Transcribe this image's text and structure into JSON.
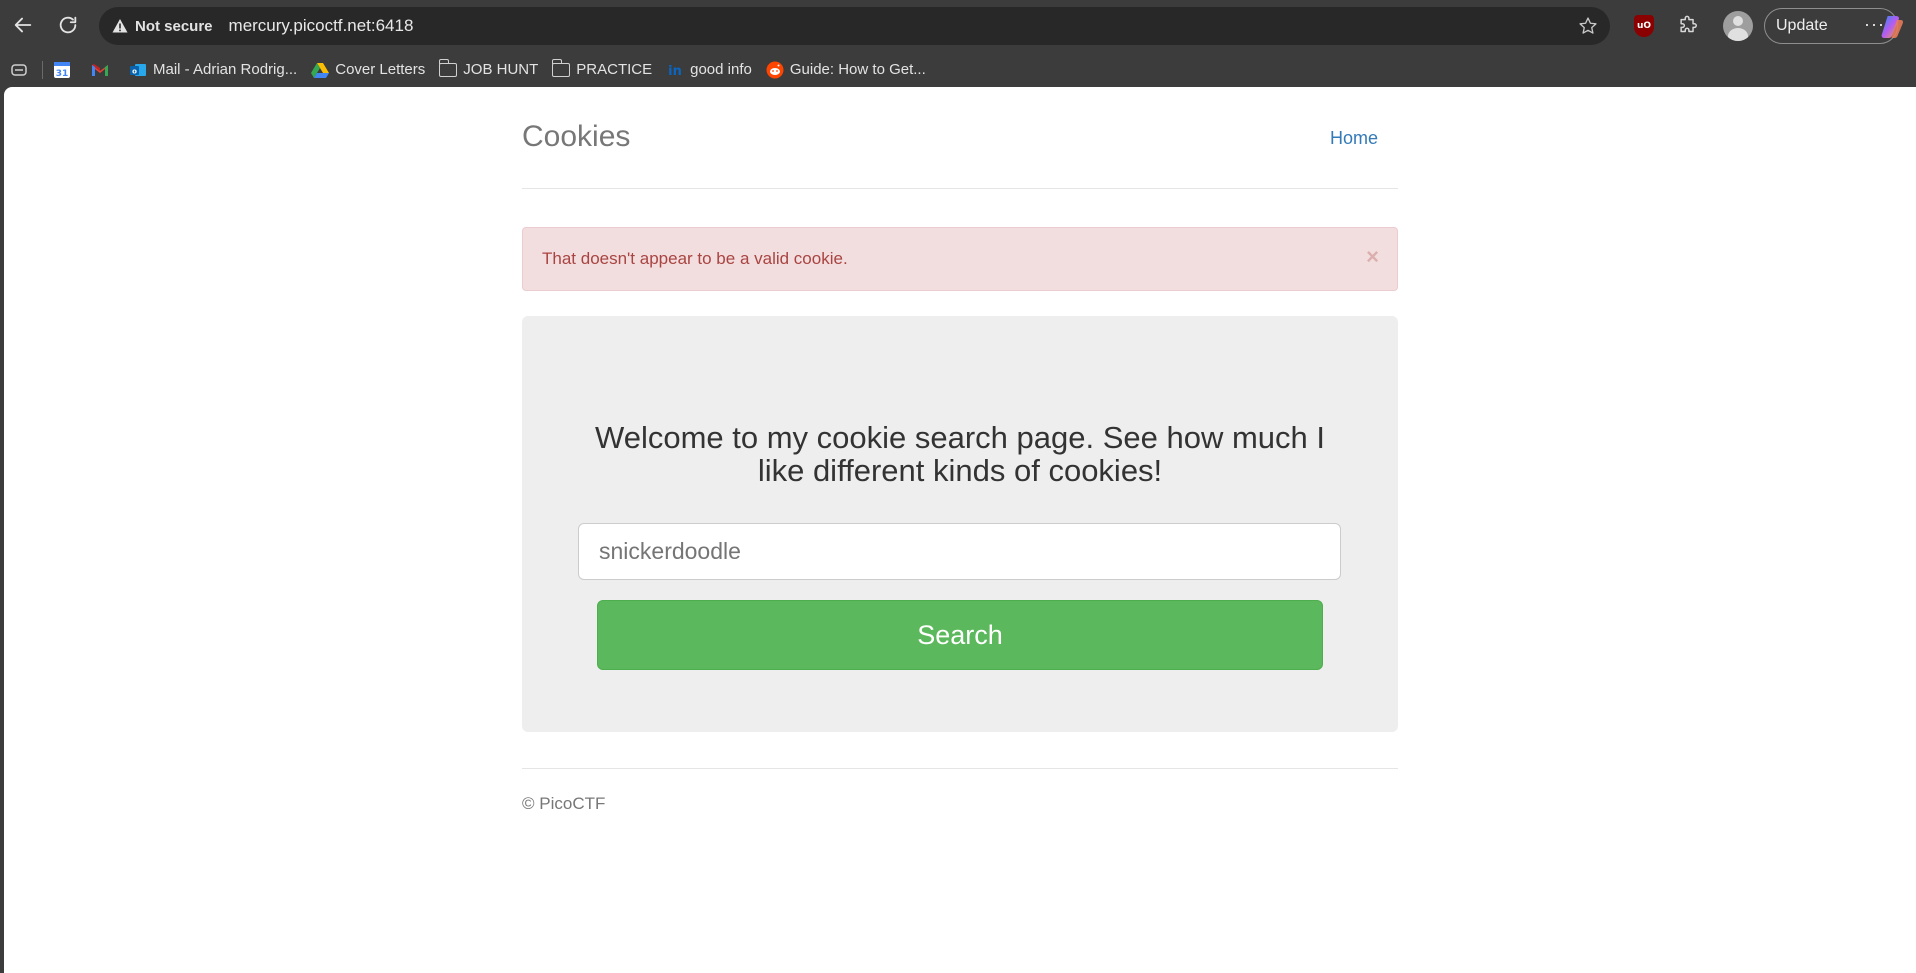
{
  "browser": {
    "security_label": "Not secure",
    "url": "mercury.picoctf.net:6418",
    "update_label": "Update",
    "ublock_badge": "uO",
    "bookmarks": [
      {
        "label": "",
        "icon": "calendar-icon"
      },
      {
        "label": "",
        "icon": "gmail-icon"
      },
      {
        "label": "Mail - Adrian Rodrig...",
        "icon": "outlook-icon"
      },
      {
        "label": "Cover Letters",
        "icon": "google-drive-icon"
      },
      {
        "label": "JOB HUNT",
        "icon": "folder-icon"
      },
      {
        "label": "PRACTICE",
        "icon": "folder-icon"
      },
      {
        "label": "good info",
        "icon": "linkedin-icon"
      },
      {
        "label": "Guide: How to Get...",
        "icon": "reddit-icon"
      }
    ]
  },
  "page": {
    "brand": "Cookies",
    "nav": {
      "home": "Home"
    },
    "alert": {
      "message": "That doesn't appear to be a valid cookie.",
      "close": "×"
    },
    "jumbotron": {
      "heading": "Welcome to my cookie search page. See how much I like different kinds of cookies!",
      "search_placeholder": "snickerdoodle",
      "search_value": "",
      "search_button": "Search"
    },
    "footer": "© PicoCTF"
  },
  "colors": {
    "alert_bg": "#f2dede",
    "alert_text": "#a94442",
    "button_green": "#5cb85c",
    "link_blue": "#337ab7",
    "jumbotron_bg": "#eeeeee"
  }
}
